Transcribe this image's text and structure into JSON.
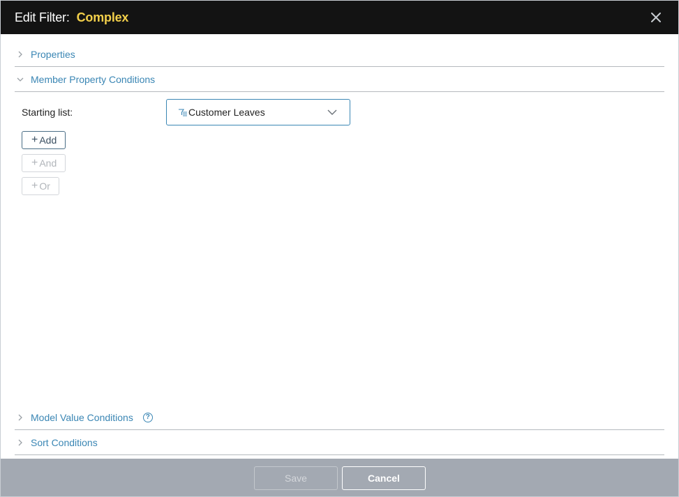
{
  "dialog": {
    "title_prefix": "Edit Filter:",
    "title_name": "Complex"
  },
  "sections": {
    "properties": "Properties",
    "member_property_conditions": "Member Property Conditions",
    "model_value_conditions": "Model Value Conditions",
    "sort_conditions": "Sort Conditions"
  },
  "member_conditions": {
    "starting_list_label": "Starting list:",
    "starting_list_value": "Customer Leaves",
    "add_label": "Add",
    "and_label": "And",
    "or_label": "Or"
  },
  "footer": {
    "save_label": "Save",
    "cancel_label": "Cancel"
  },
  "icons": {
    "close": "close-icon",
    "chevron_right": "chevron-right-icon",
    "chevron_down": "chevron-down-icon",
    "help": "help-icon",
    "list": "list-filter-icon"
  },
  "colors": {
    "titlebar_bg": "#131313",
    "title_accent": "#f2cf4a",
    "link": "#3a86b4",
    "footer_bg": "#a3a9b2"
  }
}
